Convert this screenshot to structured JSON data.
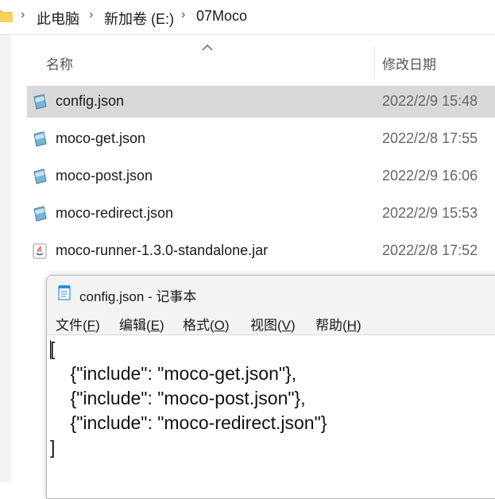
{
  "breadcrumb": {
    "items": [
      "此电脑",
      "新加卷 (E:)",
      "07Moco"
    ],
    "separator": "›"
  },
  "columns": {
    "name": "名称",
    "modified": "修改日期"
  },
  "files": [
    {
      "name": "config.json",
      "modified": "2022/2/9 15:48",
      "icon": "json-file-icon",
      "selected": true
    },
    {
      "name": "moco-get.json",
      "modified": "2022/2/8 17:55",
      "icon": "json-file-icon",
      "selected": false
    },
    {
      "name": "moco-post.json",
      "modified": "2022/2/9 16:06",
      "icon": "json-file-icon",
      "selected": false
    },
    {
      "name": "moco-redirect.json",
      "modified": "2022/2/9 15:53",
      "icon": "json-file-icon",
      "selected": false
    },
    {
      "name": "moco-runner-1.3.0-standalone.jar",
      "modified": "2022/2/8 17:52",
      "icon": "java-jar-icon",
      "selected": false
    }
  ],
  "notepad": {
    "title": "config.json - 记事本",
    "menu": [
      {
        "label": "文件",
        "accel": "F"
      },
      {
        "label": "编辑",
        "accel": "E"
      },
      {
        "label": "格式",
        "accel": "O"
      },
      {
        "label": "视图",
        "accel": "V"
      },
      {
        "label": "帮助",
        "accel": "H"
      }
    ],
    "content_lines": [
      "[",
      "    {\"include\": \"moco-get.json\"},",
      "    {\"include\": \"moco-post.json\"},",
      "    {\"include\": \"moco-redirect.json\"}",
      "]"
    ]
  },
  "colors": {
    "selected_row": "#d9d9d9",
    "folder": "#f0c040",
    "notepad_icon": "#2b8fd8"
  }
}
